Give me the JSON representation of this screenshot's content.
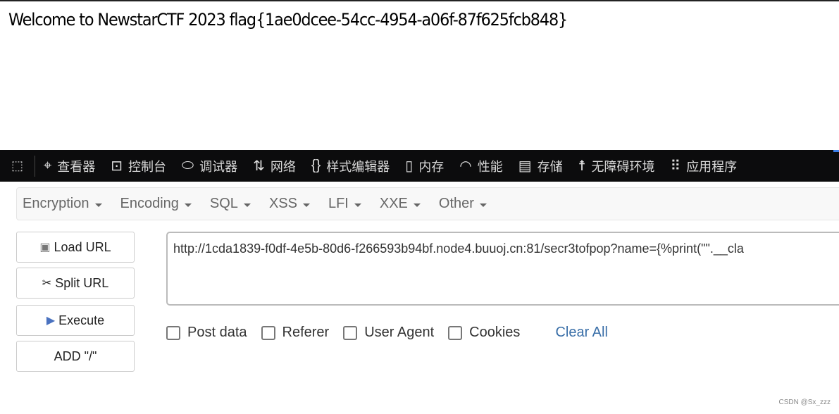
{
  "page": {
    "welcome_text": "Welcome to NewstarCTF 2023 flag{1ae0dcee-54cc-4954-a06f-87f625fcb848}"
  },
  "devtools": {
    "tabs": [
      {
        "label": "查看器",
        "icon": "inspector-icon"
      },
      {
        "label": "控制台",
        "icon": "console-icon"
      },
      {
        "label": "调试器",
        "icon": "debugger-icon"
      },
      {
        "label": "网络",
        "icon": "network-icon"
      },
      {
        "label": "样式编辑器",
        "icon": "style-editor-icon"
      },
      {
        "label": "内存",
        "icon": "memory-icon"
      },
      {
        "label": "性能",
        "icon": "performance-icon"
      },
      {
        "label": "存储",
        "icon": "storage-icon"
      },
      {
        "label": "无障碍环境",
        "icon": "accessibility-icon"
      },
      {
        "label": "应用程序",
        "icon": "application-icon"
      }
    ]
  },
  "hackbar": {
    "menus": [
      "Encryption",
      "Encoding",
      "SQL",
      "XSS",
      "LFI",
      "XXE",
      "Other"
    ],
    "buttons": {
      "load": "Load URL",
      "split": "Split URL",
      "execute": "Execute",
      "add_slash": "ADD \"/\""
    },
    "url": "http://1cda1839-f0df-4e5b-80d6-f266593b94bf.node4.buuoj.cn:81/secr3tofpop?name={%print(\"\".__cla",
    "checkboxes": [
      "Post data",
      "Referer",
      "User Agent",
      "Cookies"
    ],
    "clear_all": "Clear All"
  },
  "watermark": "CSDN @Sx_zzz"
}
